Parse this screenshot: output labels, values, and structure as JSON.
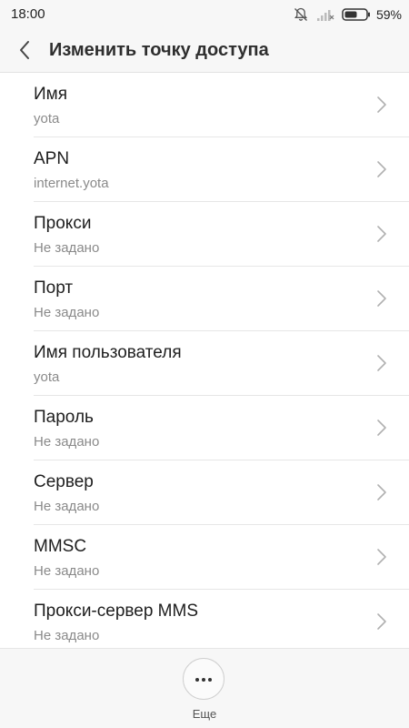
{
  "status_bar": {
    "time": "18:00",
    "battery_percent": "59%",
    "battery_level": 0.59,
    "icons": [
      "bell-off-icon",
      "signal-icon",
      "battery-icon"
    ]
  },
  "header": {
    "back_icon": "chevron-left-icon",
    "title": "Изменить точку доступа"
  },
  "settings": {
    "items": [
      {
        "title": "Имя",
        "value": "yota"
      },
      {
        "title": "APN",
        "value": "internet.yota"
      },
      {
        "title": "Прокси",
        "value": "Не задано"
      },
      {
        "title": "Порт",
        "value": "Не задано"
      },
      {
        "title": "Имя пользователя",
        "value": "yota"
      },
      {
        "title": "Пароль",
        "value": "Не задано"
      },
      {
        "title": "Сервер",
        "value": "Не задано"
      },
      {
        "title": "MMSC",
        "value": "Не задано"
      },
      {
        "title": "Прокси-сервер MMS",
        "value": "Не задано"
      }
    ]
  },
  "bottom_bar": {
    "more_icon": "more-dots-icon",
    "more_label": "Еще"
  },
  "colors": {
    "bar_background": "#f7f7f7",
    "title_text": "#1e1e1e",
    "secondary_text": "#8a8a8a",
    "divider": "#e6e6e6"
  }
}
